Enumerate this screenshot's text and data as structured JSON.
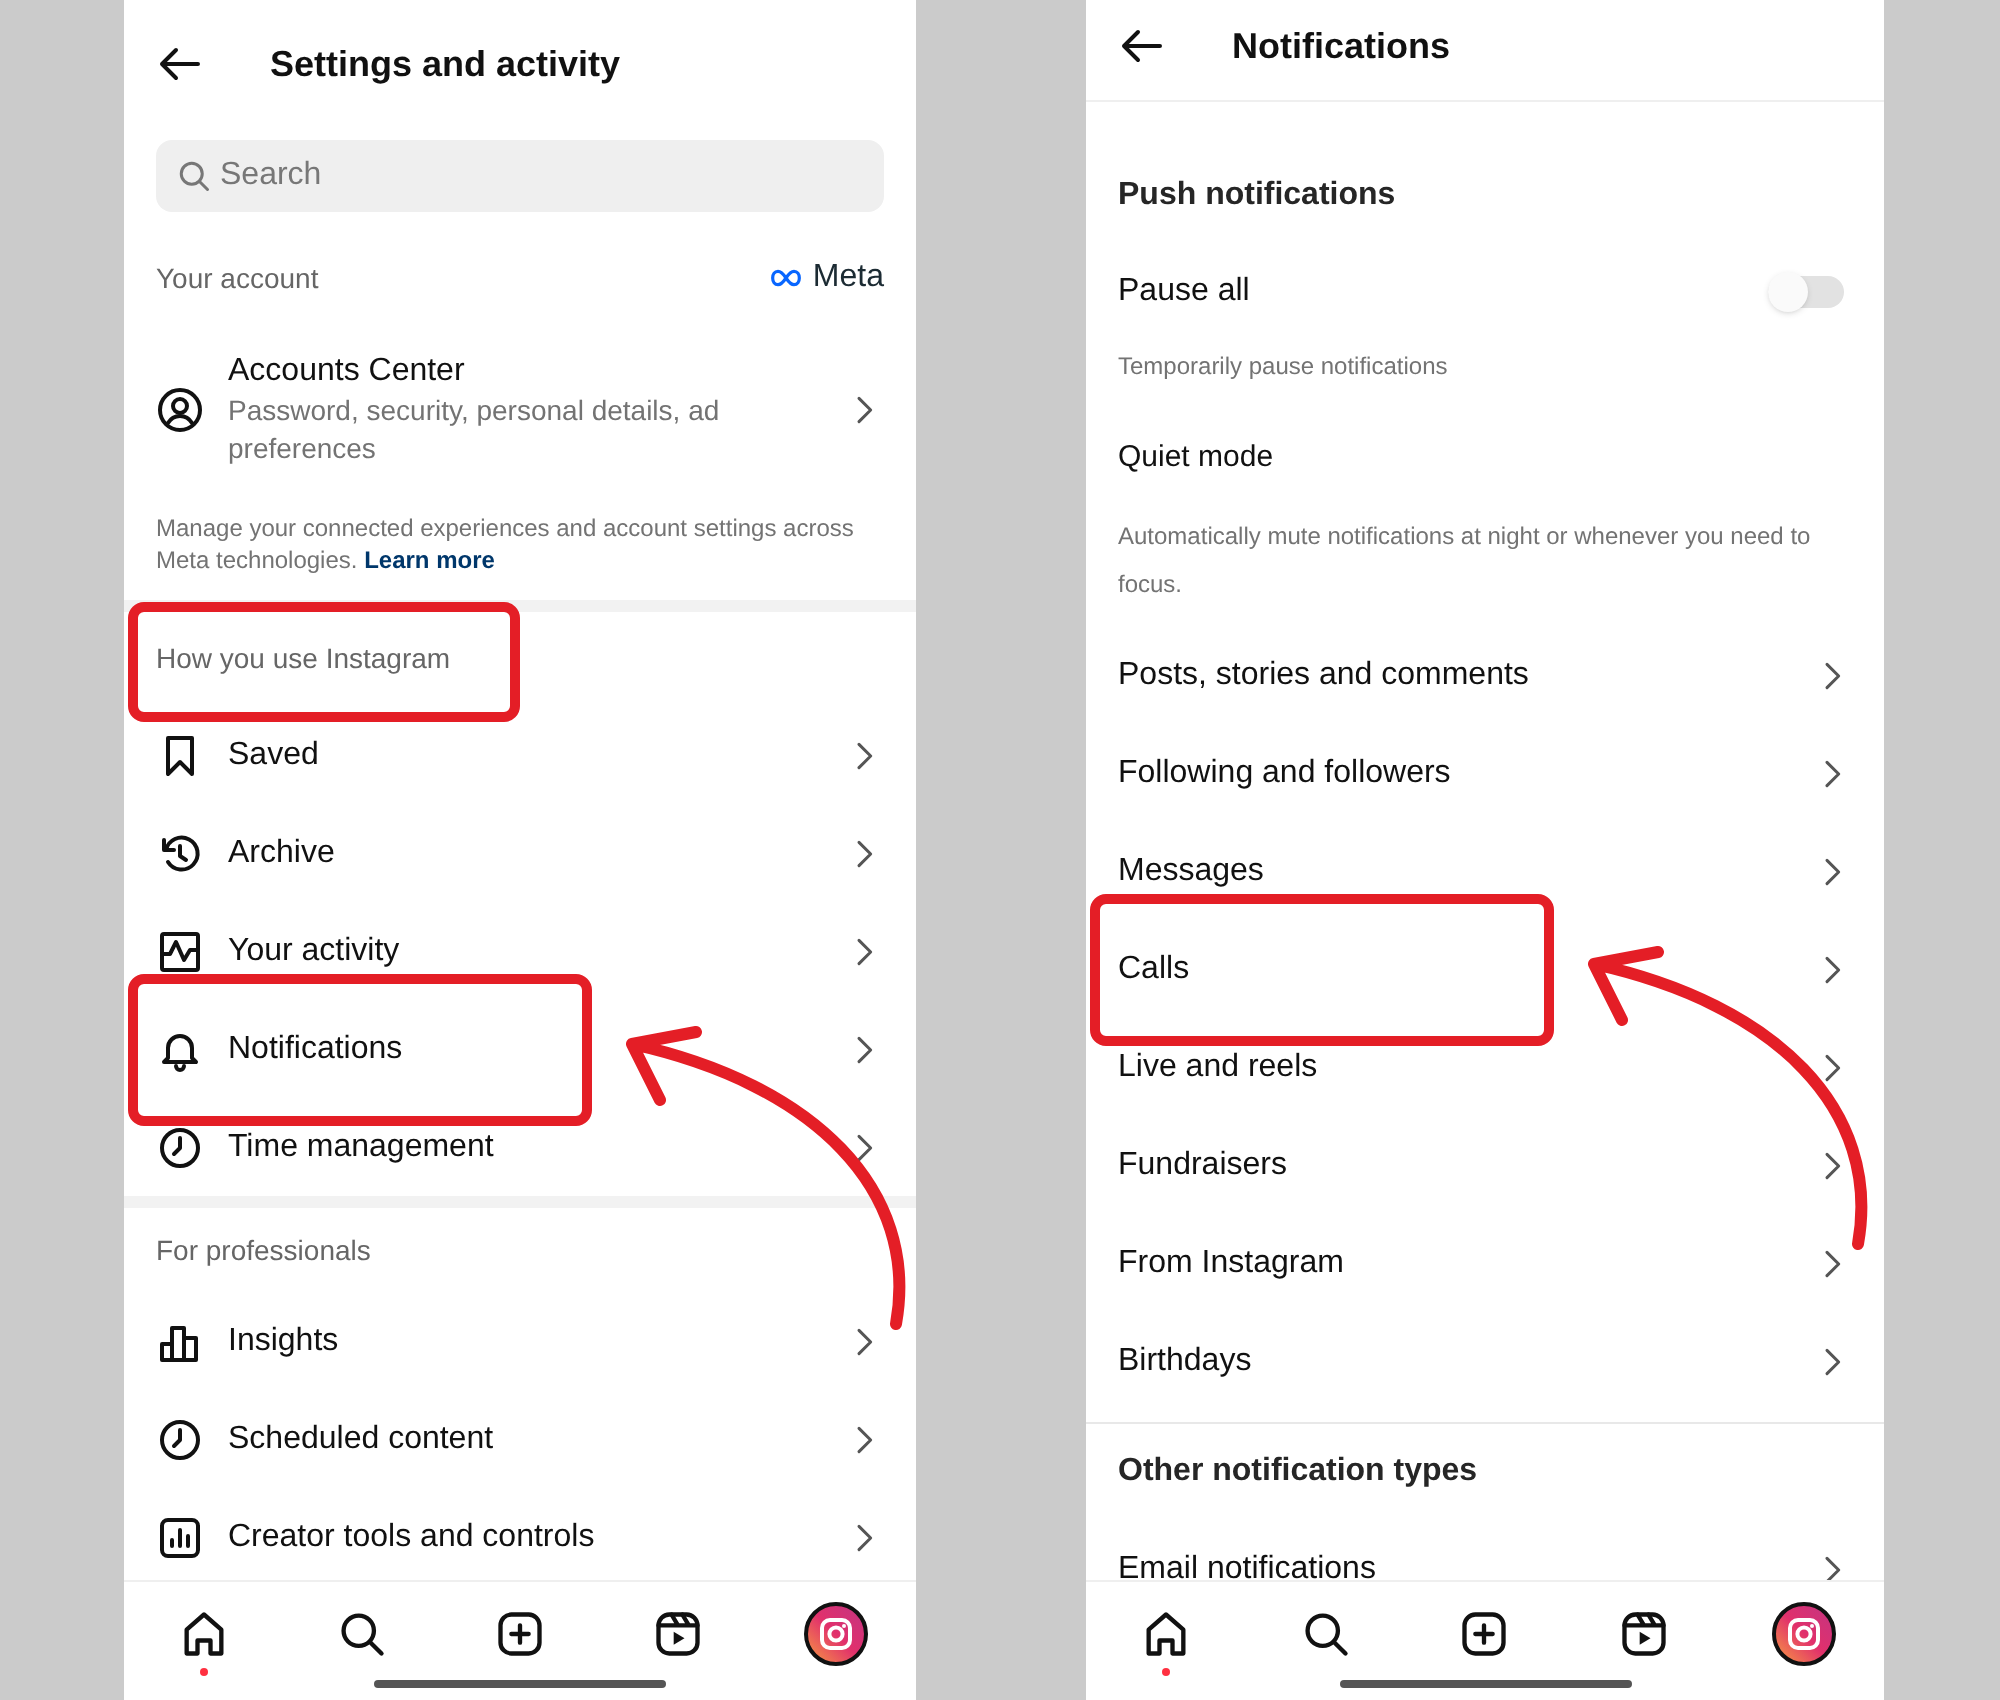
{
  "screens": [
    {
      "title": "Settings and activity",
      "items": [
        {
          "kind": "search",
          "placeholder": "Search"
        },
        {
          "kind": "header",
          "text": "Your account",
          "brand": "Meta"
        },
        {
          "kind": "account",
          "title": "Accounts Center",
          "subtitle": "Password, security, personal details, ad preferences"
        },
        {
          "kind": "note",
          "text": "Manage your connected experiences and account settings across Meta technologies.",
          "link": "Learn more"
        },
        {
          "kind": "band"
        },
        {
          "kind": "subheader",
          "text": "How you use Instagram",
          "highlighted": true
        },
        {
          "kind": "row",
          "label": "Saved",
          "highlighted": false,
          "arrow": false
        },
        {
          "kind": "row",
          "label": "Archive",
          "highlighted": false,
          "arrow": false
        },
        {
          "kind": "row",
          "label": "Your activity",
          "highlighted": false,
          "arrow": false
        },
        {
          "kind": "row",
          "label": "Notifications",
          "highlighted": true,
          "arrow": true
        },
        {
          "kind": "row",
          "label": "Time management",
          "highlighted": false,
          "arrow": false
        },
        {
          "kind": "band"
        },
        {
          "kind": "subheader",
          "text": "For professionals",
          "highlighted": false
        },
        {
          "kind": "row",
          "label": "Insights",
          "highlighted": false,
          "arrow": false
        },
        {
          "kind": "row",
          "label": "Scheduled content",
          "highlighted": false,
          "arrow": false
        },
        {
          "kind": "row",
          "label": "Creator tools and controls",
          "highlighted": false,
          "arrow": false
        }
      ],
      "nav": [
        {
          "kind": "home",
          "dot": true
        },
        {
          "kind": "search",
          "dot": false
        },
        {
          "kind": "create",
          "dot": false
        },
        {
          "kind": "reels",
          "dot": false
        },
        {
          "kind": "profile",
          "dot": false
        }
      ]
    },
    {
      "title": "Notifications",
      "items": [
        {
          "kind": "section",
          "text": "Push notifications"
        },
        {
          "kind": "toggle",
          "label": "Pause all",
          "on": false
        },
        {
          "kind": "caption",
          "text": "Temporarily pause notifications"
        },
        {
          "kind": "label",
          "text": "Quiet mode"
        },
        {
          "kind": "caption2",
          "text": "Automatically mute notifications at night or whenever you need to focus."
        },
        {
          "kind": "row",
          "label": "Posts, stories and comments",
          "highlighted": false,
          "arrow": false
        },
        {
          "kind": "row",
          "label": "Following and followers",
          "highlighted": false,
          "arrow": false
        },
        {
          "kind": "row",
          "label": "Messages",
          "highlighted": false,
          "arrow": false
        },
        {
          "kind": "row",
          "label": "Calls",
          "highlighted": true,
          "arrow": true
        },
        {
          "kind": "row",
          "label": "Live and reels",
          "highlighted": false,
          "arrow": false
        },
        {
          "kind": "row",
          "label": "Fundraisers",
          "highlighted": false,
          "arrow": false
        },
        {
          "kind": "row",
          "label": "From Instagram",
          "highlighted": false,
          "arrow": false
        },
        {
          "kind": "row",
          "label": "Birthdays",
          "highlighted": false,
          "arrow": false
        },
        {
          "kind": "line"
        },
        {
          "kind": "section2",
          "text": "Other notification types"
        },
        {
          "kind": "row",
          "label": "Email notifications",
          "highlighted": false,
          "arrow": false
        }
      ],
      "nav": [
        {
          "kind": "home",
          "dot": true
        },
        {
          "kind": "search",
          "dot": false
        },
        {
          "kind": "create",
          "dot": false
        },
        {
          "kind": "reels",
          "dot": false
        },
        {
          "kind": "profile",
          "dot": false
        }
      ]
    }
  ]
}
